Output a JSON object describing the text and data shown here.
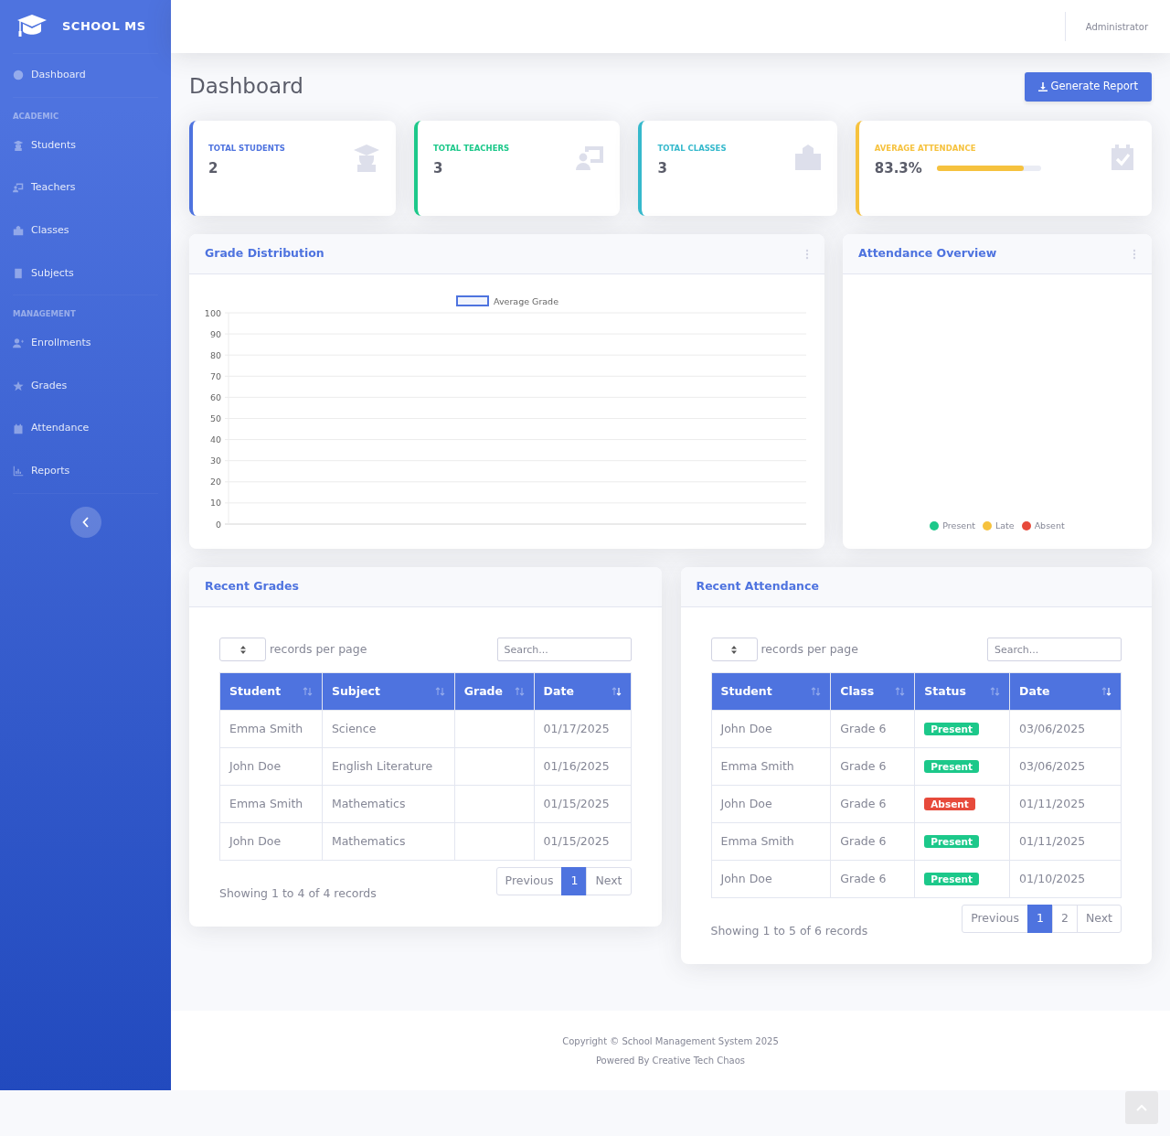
{
  "sidebar": {
    "brand": "SCHOOL MS",
    "sections": [
      {
        "items": [
          {
            "label": "Dashboard"
          }
        ]
      },
      {
        "heading": "ACADEMIC",
        "items": [
          {
            "label": "Students"
          },
          {
            "label": "Teachers"
          },
          {
            "label": "Classes"
          },
          {
            "label": "Subjects"
          }
        ]
      },
      {
        "heading": "MANAGEMENT",
        "items": [
          {
            "label": "Enrollments"
          },
          {
            "label": "Grades"
          },
          {
            "label": "Attendance"
          },
          {
            "label": "Reports"
          }
        ]
      }
    ]
  },
  "topbar": {
    "user": "Administrator"
  },
  "page": {
    "title": "Dashboard",
    "action": "Generate Report"
  },
  "stats": [
    {
      "label": "TOTAL STUDENTS",
      "value": "2",
      "color": "#4e73df"
    },
    {
      "label": "TOTAL TEACHERS",
      "value": "3",
      "color": "#1cc88a"
    },
    {
      "label": "TOTAL CLASSES",
      "value": "3",
      "color": "#36b9cc"
    },
    {
      "label": "AVERAGE ATTENDANCE",
      "value": "83.3%",
      "color": "#f6c23e",
      "level": 0.833
    }
  ],
  "grade_chart": {
    "title": "Grade Distribution",
    "chart_data": {
      "type": "bar",
      "series": [
        {
          "name": "Average Grade",
          "color": "#4e73df"
        }
      ],
      "grid": true,
      "ylim": [
        0,
        100
      ],
      "yticks": [
        0,
        10,
        20,
        30,
        40,
        50,
        60,
        70,
        80,
        90,
        100
      ]
    }
  },
  "attendance_chart": {
    "title": "Attendance Overview",
    "legend": [
      {
        "label": "Present",
        "color": "#1cc88a"
      },
      {
        "label": "Late",
        "color": "#f6c23e"
      },
      {
        "label": "Absent",
        "color": "#e74a3b"
      }
    ]
  },
  "recent_grades": {
    "title": "Recent Grades",
    "length_label": "records per page",
    "search_placeholder": "Search...",
    "columns": [
      {
        "label": "Student",
        "sorted": false
      },
      {
        "label": "Subject",
        "sorted": false
      },
      {
        "label": "Grade",
        "sorted": false
      },
      {
        "label": "Date",
        "sorted": true
      }
    ],
    "rows": [
      [
        "Emma Smith",
        "Science",
        "",
        "01/17/2025"
      ],
      [
        "John Doe",
        "English Literature",
        "",
        "01/16/2025"
      ],
      [
        "Emma Smith",
        "Mathematics",
        "",
        "01/15/2025"
      ],
      [
        "John Doe",
        "Mathematics",
        "",
        "01/15/2025"
      ]
    ],
    "info": "Showing 1 to 4 of 4 records",
    "pager": [
      {
        "label": "Previous",
        "selected": false
      },
      {
        "label": "1",
        "selected": true
      },
      {
        "label": "Next",
        "selected": false
      }
    ]
  },
  "recent_attendance": {
    "title": "Recent Attendance",
    "length_label": "records per page",
    "search_placeholder": "Search...",
    "columns": [
      {
        "label": "Student",
        "sorted": false
      },
      {
        "label": "Class",
        "sorted": false
      },
      {
        "label": "Status",
        "sorted": false
      },
      {
        "label": "Date",
        "sorted": true
      }
    ],
    "rows": [
      {
        "student": "John Doe",
        "class": "Grade 6",
        "status": {
          "label": "Present",
          "color": "#1cc88a"
        },
        "date": "03/06/2025"
      },
      {
        "student": "Emma Smith",
        "class": "Grade 6",
        "status": {
          "label": "Present",
          "color": "#1cc88a"
        },
        "date": "03/06/2025"
      },
      {
        "student": "John Doe",
        "class": "Grade 6",
        "status": {
          "label": "Absent",
          "color": "#e74a3b"
        },
        "date": "01/11/2025"
      },
      {
        "student": "Emma Smith",
        "class": "Grade 6",
        "status": {
          "label": "Present",
          "color": "#1cc88a"
        },
        "date": "01/11/2025"
      },
      {
        "student": "John Doe",
        "class": "Grade 6",
        "status": {
          "label": "Present",
          "color": "#1cc88a"
        },
        "date": "01/10/2025"
      }
    ],
    "info": "Showing 1 to 5 of 6 records",
    "pager": [
      {
        "label": "Previous",
        "selected": false
      },
      {
        "label": "1",
        "selected": true
      },
      {
        "label": "2",
        "selected": false
      },
      {
        "label": "Next",
        "selected": false
      }
    ]
  },
  "footer": {
    "lines": [
      "Copyright © School Management System 2025",
      "Powered By Creative Tech Chaos"
    ]
  }
}
